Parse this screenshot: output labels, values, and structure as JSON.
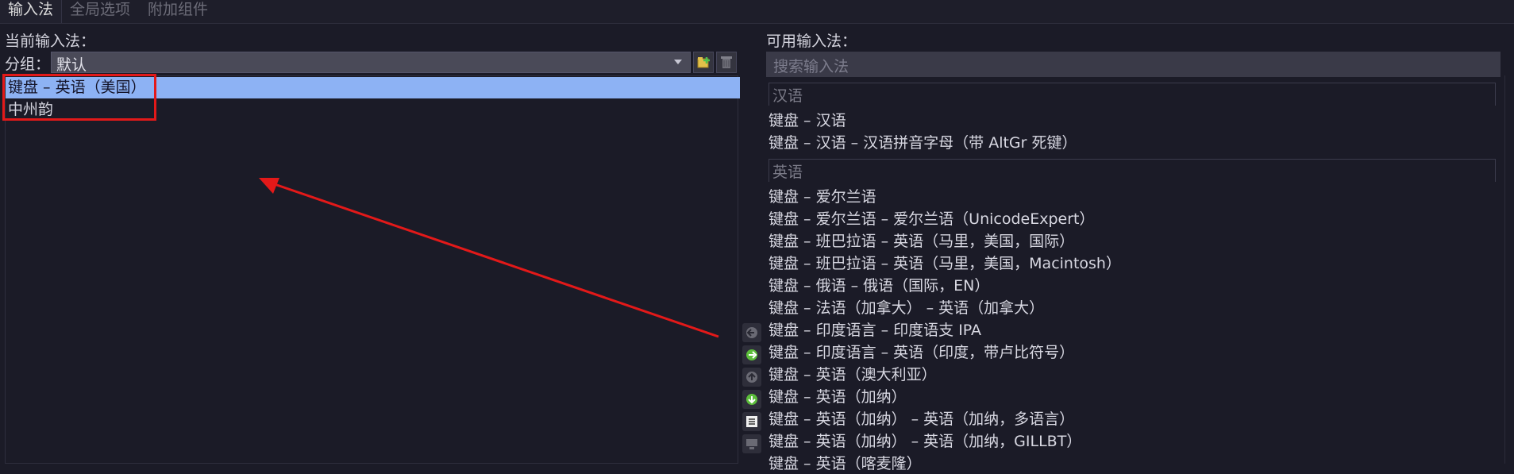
{
  "tabs": [
    {
      "label": "输入法"
    },
    {
      "label": "全局选项"
    },
    {
      "label": "附加组件"
    }
  ],
  "left": {
    "title": "当前输入法：",
    "group_label": "分组：",
    "group_value": "默认",
    "items": [
      {
        "label": "键盘 – 英语（美国）"
      },
      {
        "label": "中州韵"
      }
    ]
  },
  "right": {
    "title": "可用输入法：",
    "search_placeholder": "搜索输入法",
    "categories": [
      {
        "label": "汉语"
      },
      {
        "label": "英语"
      }
    ],
    "items": [
      {
        "label": "键盘 – 汉语"
      },
      {
        "label": "键盘 – 汉语 – 汉语拼音字母（带 AltGr 死键）"
      },
      {
        "label": "键盘 – 爱尔兰语"
      },
      {
        "label": "键盘 – 爱尔兰语 – 爱尔兰语（UnicodeExpert）"
      },
      {
        "label": "键盘 – 班巴拉语 – 英语（马里，美国，国际）"
      },
      {
        "label": "键盘 – 班巴拉语 – 英语（马里，美国，Macintosh）"
      },
      {
        "label": "键盘 – 俄语 – 俄语（国际，EN）"
      },
      {
        "label": "键盘 – 法语（加拿大） – 英语（加拿大）"
      },
      {
        "label": "键盘 – 印度语言 – 印度语支 IPA"
      },
      {
        "label": "键盘 – 印度语言 – 英语（印度，带卢比符号）"
      },
      {
        "label": "键盘 – 英语（澳大利亚）"
      },
      {
        "label": "键盘 – 英语（加纳）"
      },
      {
        "label": "键盘 – 英语（加纳） – 英语（加纳，多语言）"
      },
      {
        "label": "键盘 – 英语（加纳） – 英语（加纳，GILLBT）"
      },
      {
        "label": "键盘 – 英语（喀麦隆）"
      }
    ]
  },
  "colors": {
    "selection": "#8db2f4",
    "highlight_box": "#e31919",
    "annotation_arrow": "#e31919",
    "background": "#1b1b27"
  },
  "icons": [
    "add-group-icon",
    "delete-group-icon",
    "move-left-icon",
    "move-right-icon",
    "move-up-icon",
    "move-down-icon",
    "configure-icon",
    "keyboard-layout-icon"
  ]
}
